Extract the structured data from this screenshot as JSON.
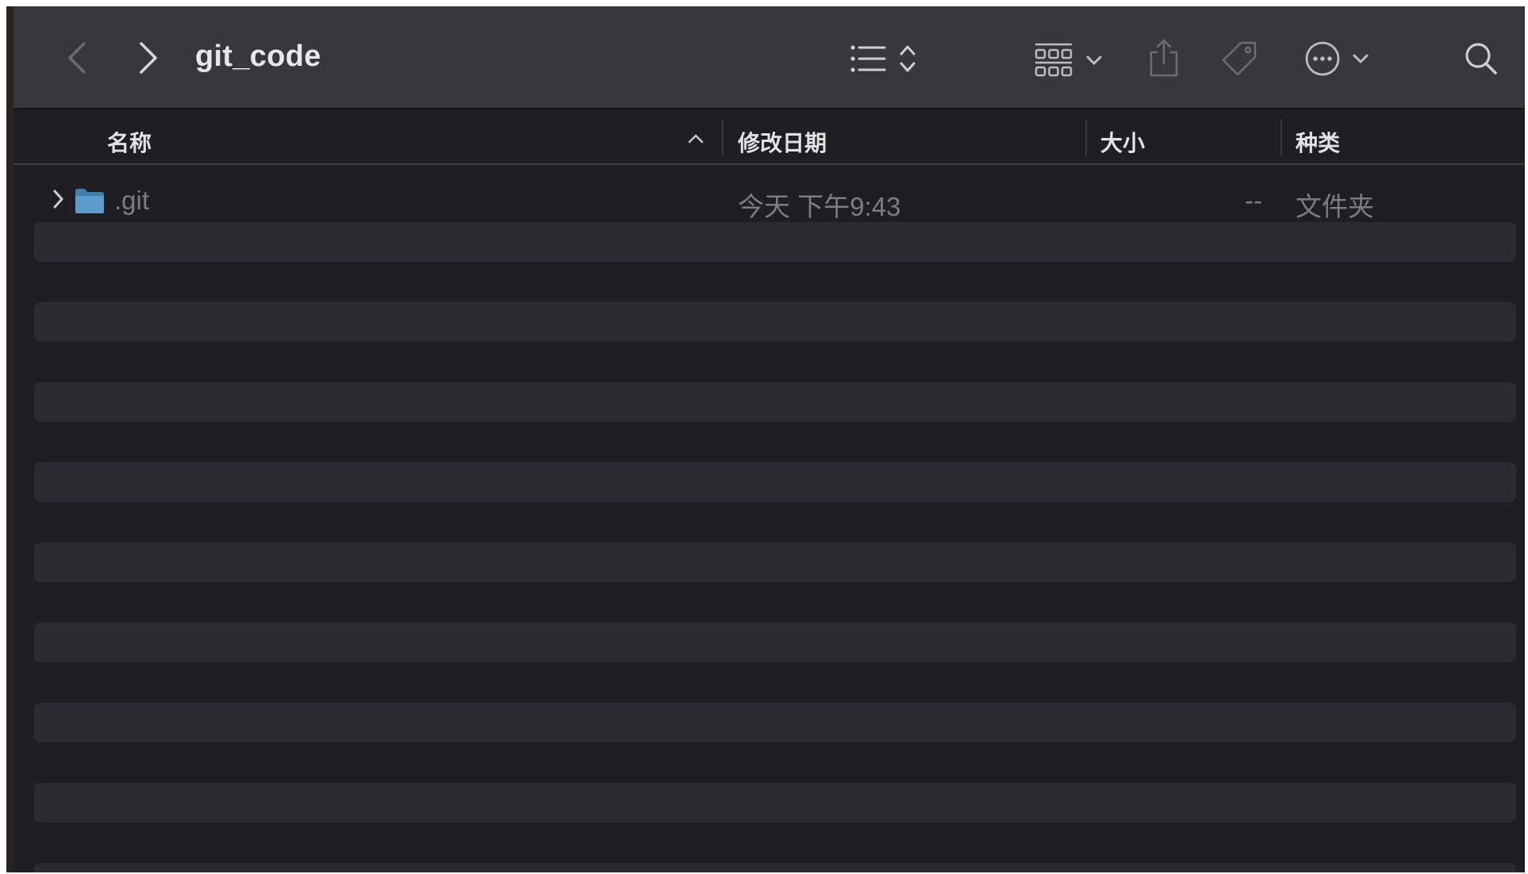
{
  "window": {
    "title": "git_code"
  },
  "toolbar": {
    "back_icon": "chevron-left-icon",
    "forward_icon": "chevron-right-icon",
    "view_list_icon": "list-icon",
    "sort_icon": "up-down-chevron-icon",
    "group_icon": "grid-icon",
    "share_icon": "share-icon",
    "tag_icon": "tag-icon",
    "more_icon": "ellipsis-circle-icon",
    "search_icon": "search-icon"
  },
  "columns": {
    "name": "名称",
    "modified": "修改日期",
    "size": "大小",
    "kind": "种类",
    "sort_indicator": "chevron-up-icon"
  },
  "rows": [
    {
      "name": ".git",
      "modified": "今天 下午9:43",
      "size": "--",
      "kind": "文件夹",
      "icon": "folder-icon"
    }
  ],
  "colors": {
    "background": "#1f1e23",
    "toolbar": "#38373b",
    "stripe": "#2c2b31",
    "folder": "#5b9ccc"
  }
}
